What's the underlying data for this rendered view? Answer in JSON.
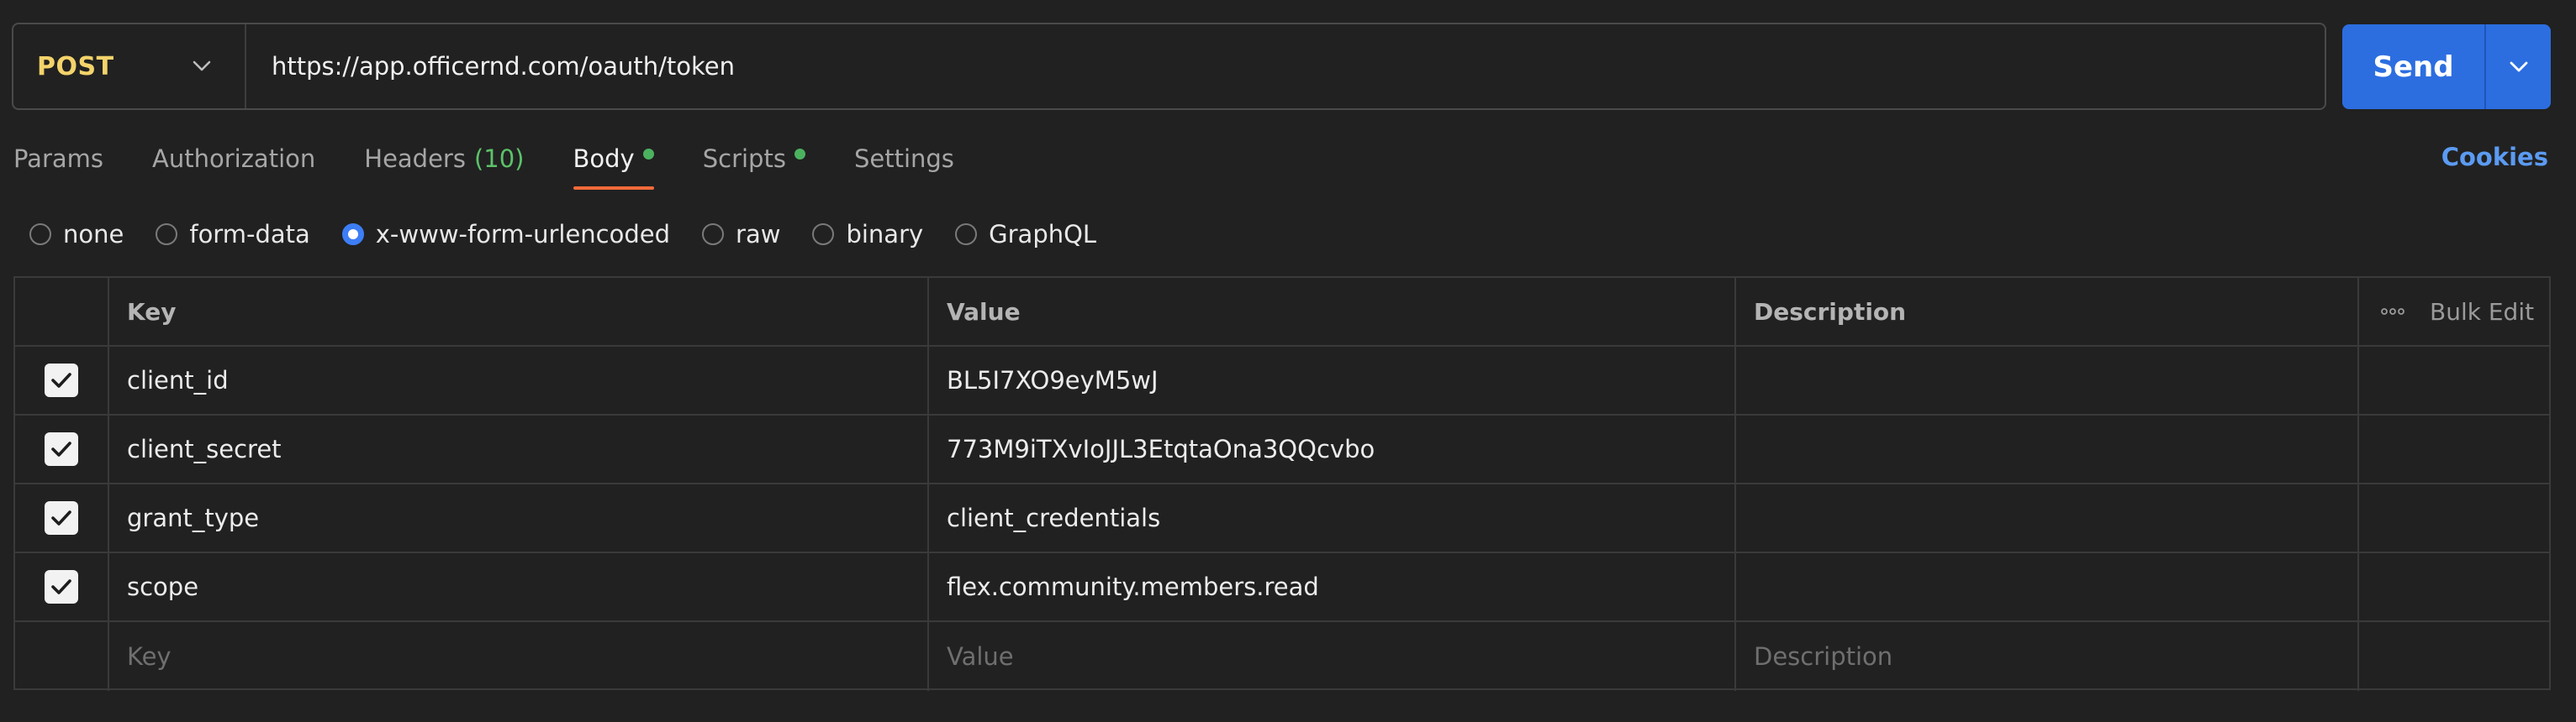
{
  "request": {
    "method": "POST",
    "url": "https://app.officernd.com/oauth/token",
    "send_label": "Send"
  },
  "tabs": [
    {
      "label": "Params"
    },
    {
      "label": "Authorization"
    },
    {
      "label": "Headers",
      "count": "(10)"
    },
    {
      "label": "Body",
      "active": true,
      "dot": true
    },
    {
      "label": "Scripts",
      "dot": true
    },
    {
      "label": "Settings"
    }
  ],
  "cookies_label": "Cookies",
  "body_types": [
    {
      "label": "none"
    },
    {
      "label": "form-data"
    },
    {
      "label": "x-www-form-urlencoded",
      "selected": true
    },
    {
      "label": "raw"
    },
    {
      "label": "binary"
    },
    {
      "label": "GraphQL"
    }
  ],
  "table": {
    "headers": {
      "key": "Key",
      "value": "Value",
      "description": "Description",
      "bulk_edit": "Bulk Edit"
    },
    "rows": [
      {
        "checked": true,
        "key": "client_id",
        "value": "BL5I7XO9eyM5wJ",
        "description": ""
      },
      {
        "checked": true,
        "key": "client_secret",
        "value": "773M9iTXvIoJJL3EtqtaOna3QQcvbo",
        "description": ""
      },
      {
        "checked": true,
        "key": "grant_type",
        "value": "client_credentials",
        "description": ""
      },
      {
        "checked": true,
        "key": "scope",
        "value": "flex.community.members.read",
        "description": ""
      }
    ],
    "placeholders": {
      "key": "Key",
      "value": "Value",
      "description": "Description"
    }
  },
  "colors": {
    "background": "#212121",
    "method": "#f3d36b",
    "send": "#2c6ee0",
    "active_tab_underline": "#f26b3a",
    "status_dot": "#4bb35f",
    "link": "#5b9bf2"
  }
}
